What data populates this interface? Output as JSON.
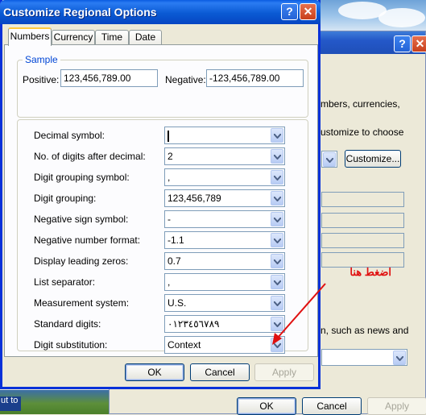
{
  "dialog": {
    "title": "Customize Regional Options",
    "tabs": [
      {
        "label": "Numbers",
        "active": true
      },
      {
        "label": "Currency",
        "active": false
      },
      {
        "label": "Time",
        "active": false
      },
      {
        "label": "Date",
        "active": false
      }
    ],
    "sample": {
      "legend": "Sample",
      "positive_label": "Positive:",
      "positive_value": "123,456,789.00",
      "negative_label": "Negative:",
      "negative_value": "-123,456,789.00"
    },
    "settings": [
      {
        "label": "Decimal symbol:",
        "value": ""
      },
      {
        "label": "No. of digits after decimal:",
        "value": "2"
      },
      {
        "label": "Digit grouping symbol:",
        "value": ","
      },
      {
        "label": "Digit grouping:",
        "value": "123,456,789"
      },
      {
        "label": "Negative sign symbol:",
        "value": "-"
      },
      {
        "label": "Negative number format:",
        "value": "-1.1"
      },
      {
        "label": "Display leading zeros:",
        "value": "0.7"
      },
      {
        "label": "List separator:",
        "value": ","
      },
      {
        "label": "Measurement system:",
        "value": "U.S."
      },
      {
        "label": "Standard digits:",
        "value": "٠١٢٣٤٥٦٧٨٩"
      },
      {
        "label": "Digit substitution:",
        "value": "Context"
      }
    ],
    "buttons": {
      "ok": "OK",
      "cancel": "Cancel",
      "apply": "Apply"
    }
  },
  "background_window": {
    "text_fragments": [
      "mbers, currencies,",
      "ustomize to choose",
      "n, such as news and"
    ],
    "customize_button": "Customize...",
    "buttons": {
      "ok": "OK",
      "cancel": "Cancel",
      "apply": "Apply"
    }
  },
  "desktop": {
    "label": "ut to"
  },
  "annotation": {
    "text": "اضغط هنا",
    "color": "#e01010"
  },
  "colors": {
    "title_bar": "#0a5ad4",
    "legend": "#0046d5",
    "tab_highlight": "#ffc83c"
  }
}
